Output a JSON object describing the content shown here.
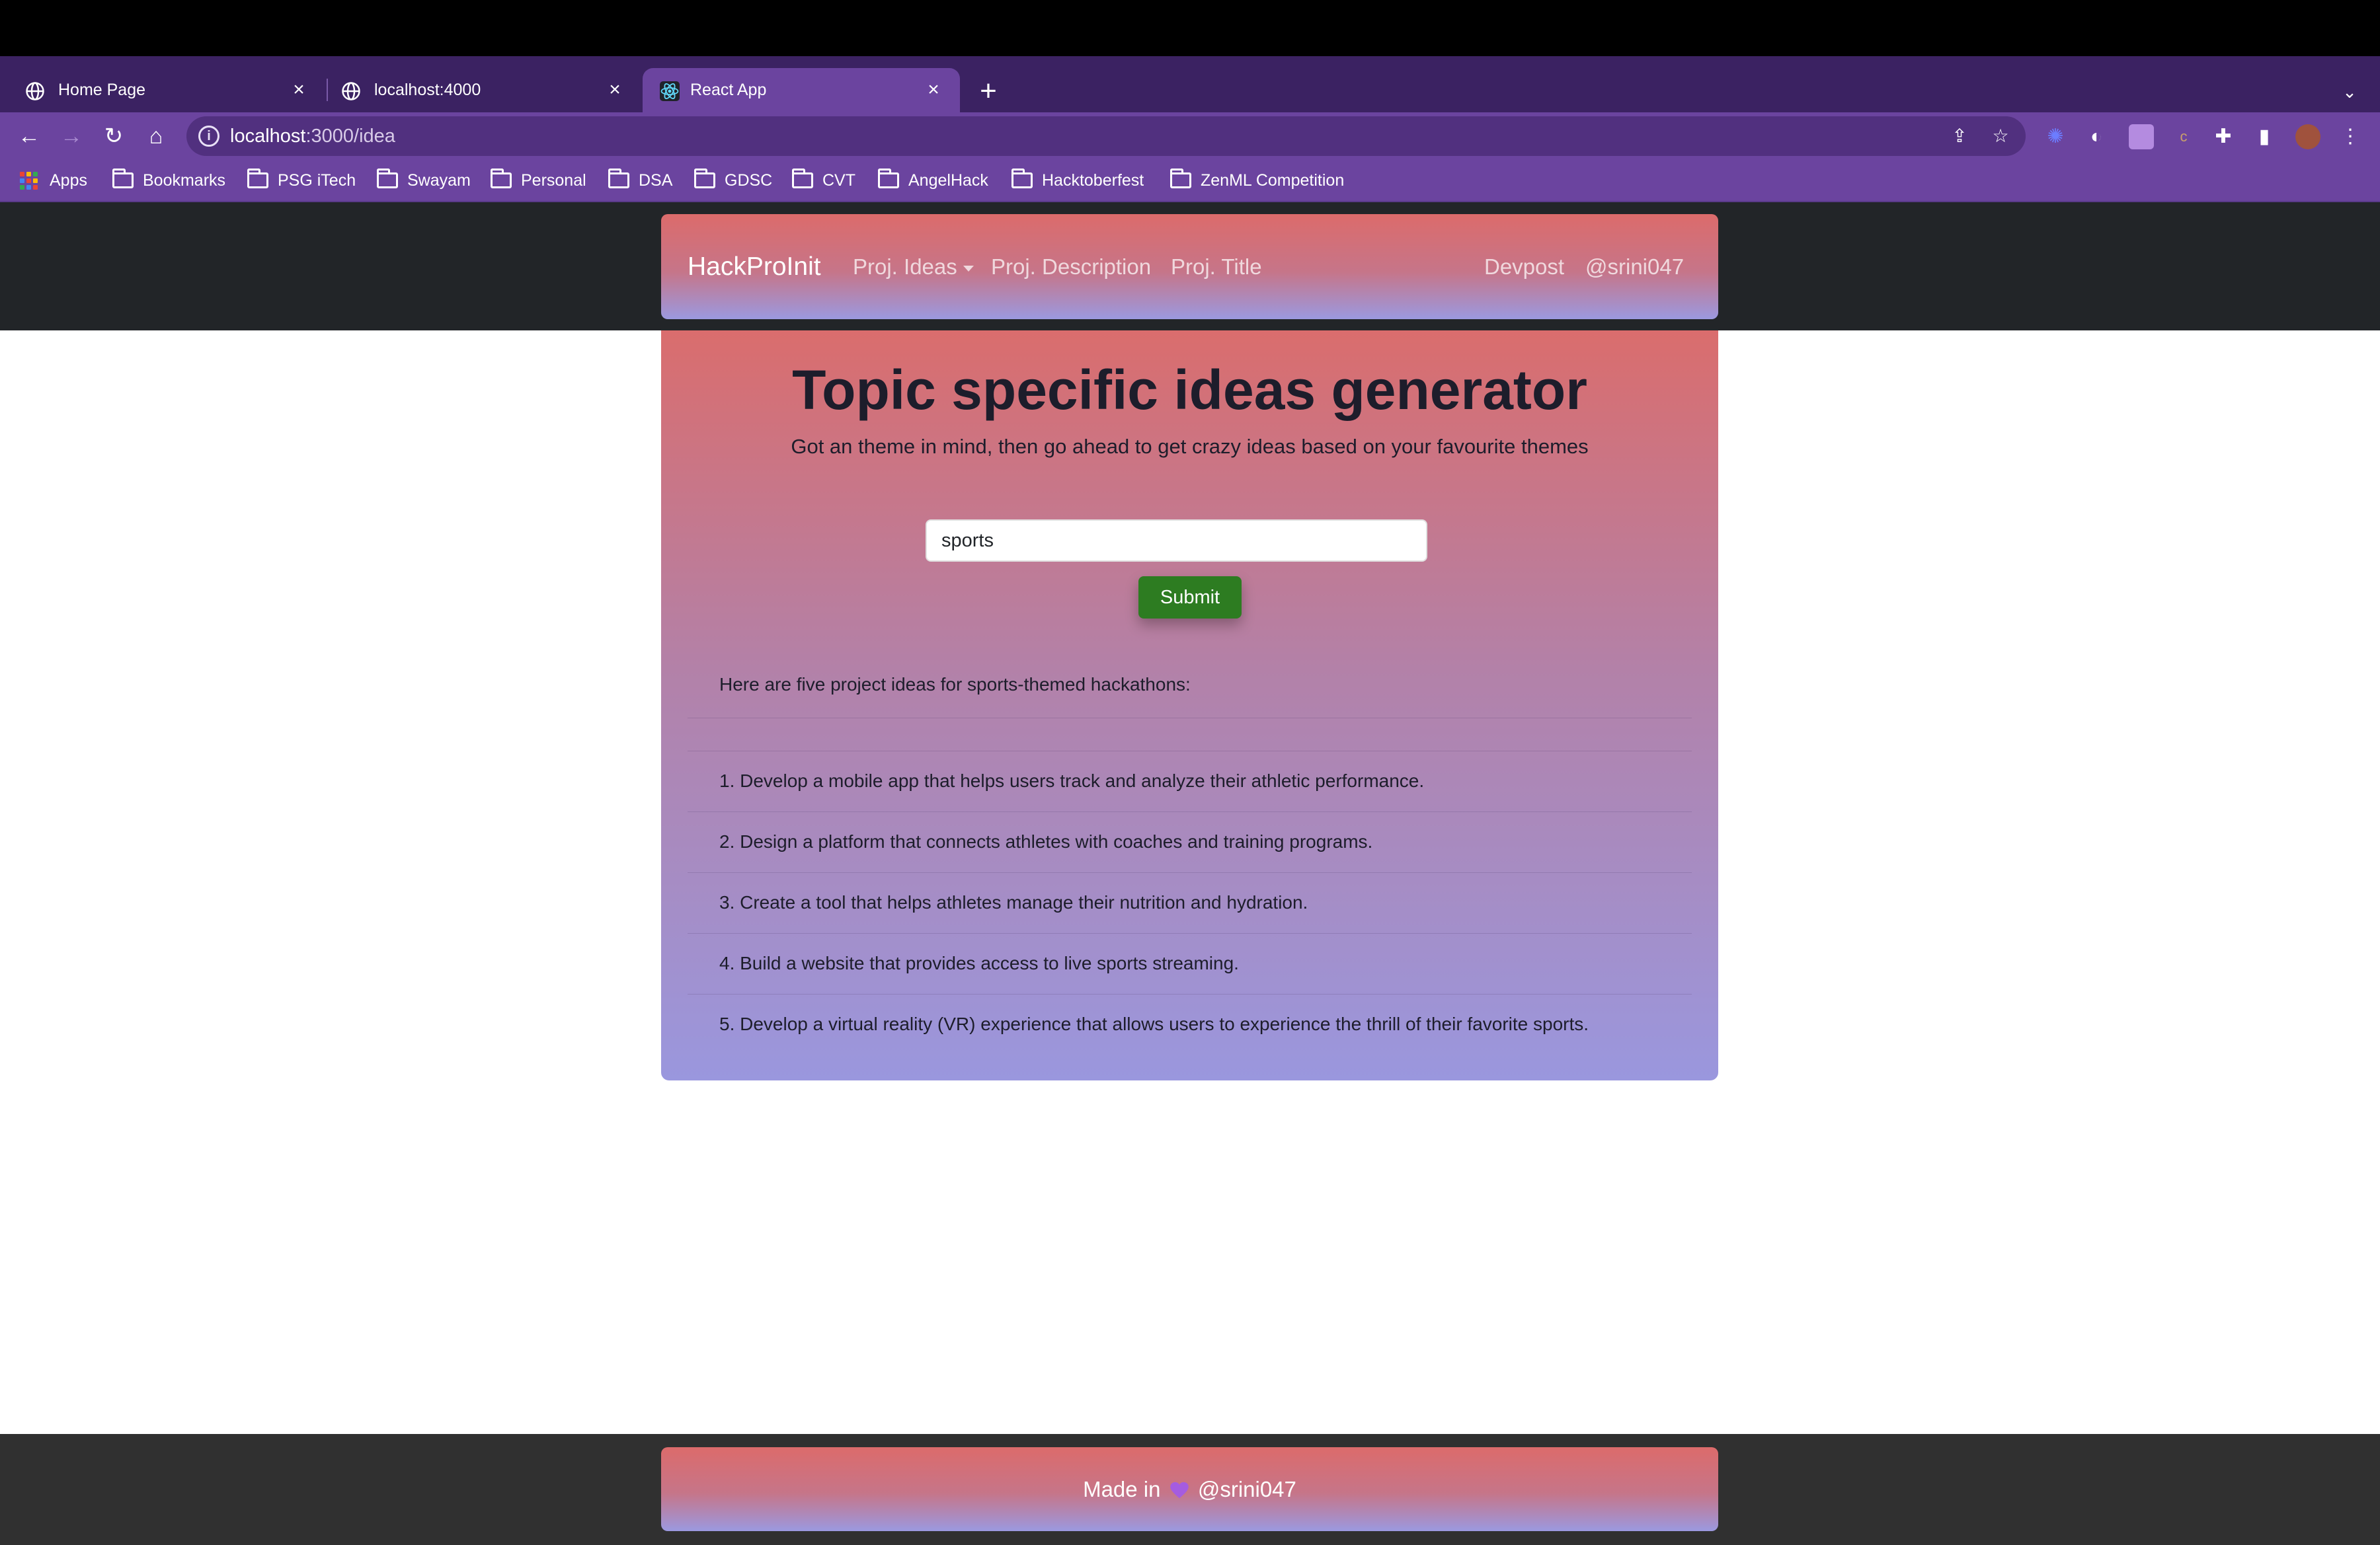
{
  "browser": {
    "tabs": [
      {
        "title": "Home Page",
        "icon": "globe-icon"
      },
      {
        "title": "localhost:4000",
        "icon": "globe-icon"
      },
      {
        "title": "React App",
        "icon": "react-icon",
        "active": true
      }
    ],
    "url": {
      "host": "localhost",
      "path": ":3000/idea"
    },
    "bookmarks": [
      "Apps",
      "Bookmarks",
      "PSG iTech",
      "Swayam",
      "Personal",
      "DSA",
      "GDSC",
      "CVT",
      "AngelHack",
      "Hacktoberfest",
      "ZenML Competition"
    ]
  },
  "navbar": {
    "brand": "HackProInit",
    "links": {
      "ideas": "Proj. Ideas",
      "description": "Proj. Description",
      "title": "Proj. Title",
      "devpost": "Devpost",
      "user": "@srini047"
    }
  },
  "main": {
    "heading": "Topic specific ideas generator",
    "subtitle": "Got an theme in mind, then go ahead to get crazy ideas based on your favourite themes",
    "topic_value": "sports",
    "submit_label": "Submit",
    "intro": "Here are five project ideas for sports-themed hackathons:",
    "ideas": [
      "1. Develop a mobile app that helps users track and analyze their athletic performance.",
      "2. Design a platform that connects athletes with coaches and training programs.",
      "3. Create a tool that helps athletes manage their nutrition and hydration.",
      "4. Build a website that provides access to live sports streaming.",
      "5. Develop a virtual reality (VR) experience that allows users to experience the thrill of their favorite sports."
    ]
  },
  "footer": {
    "prefix": "Made in",
    "suffix": "@srini047"
  },
  "colors": {
    "submit": "#2d7c21",
    "tab_active": "#6b449f",
    "navbar_band": "#222528"
  }
}
